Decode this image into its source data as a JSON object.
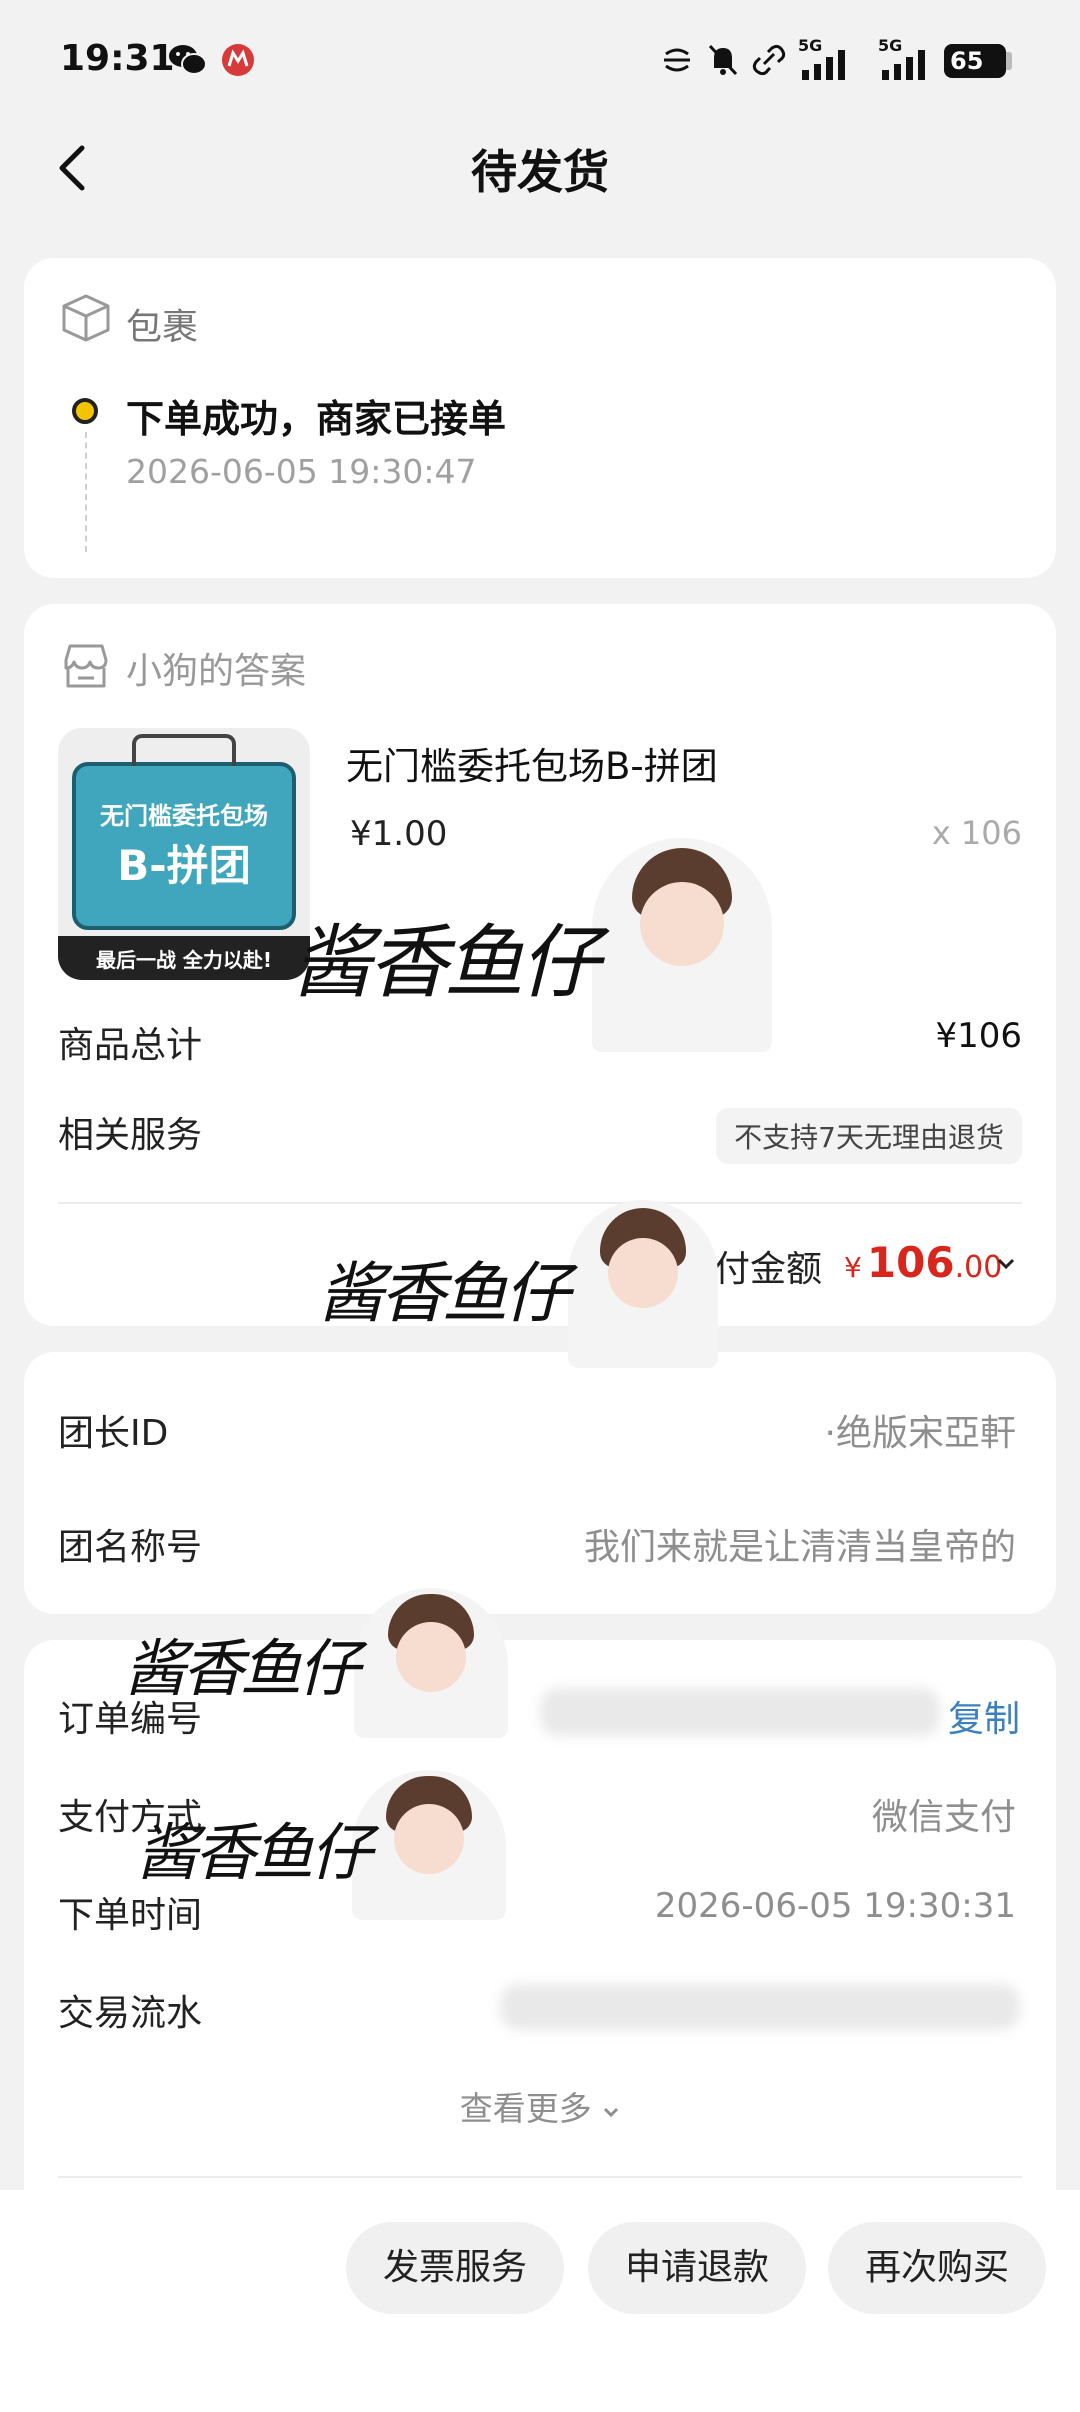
{
  "status_bar": {
    "time": "19:31",
    "battery": "65",
    "net_1": "5G",
    "net_2": "5G",
    "icons": [
      "wechat-icon",
      "app-badge-icon",
      "flash-icon",
      "mute-bell-icon",
      "link-icon",
      "signal-icon",
      "signal-icon",
      "battery-icon"
    ]
  },
  "header": {
    "title": "待发货"
  },
  "package": {
    "title": "包裹",
    "status": "下单成功，商家已接单",
    "time": "2026-06-05 19:30:47",
    "accent": "#f5c400"
  },
  "shop": {
    "name": "小狗的答案",
    "product": {
      "title": "无门槛委托包场B-拼团",
      "price": "¥1.00",
      "qty": "x 106",
      "thumb_line1": "无门槛委托包场",
      "thumb_line2": "B-拼团",
      "thumb_line3": "最后一战 全力以赴!"
    },
    "total_label": "商品总计",
    "total_value": "¥106",
    "service_label": "相关服务",
    "service_tag": "不支持7天无理由退货",
    "paid_label": "实付金额",
    "paid_symbol": "¥",
    "paid_int": "106",
    "paid_dec": ".00",
    "price_color": "#d9261c"
  },
  "group": {
    "leader_label": "团长ID",
    "leader_value": "·绝版宋亞軒",
    "name_label": "团名称号",
    "name_value": "我们来就是让清清当皇帝的"
  },
  "order": {
    "number_label": "订单编号",
    "copy_label": "复制",
    "pay_label": "支付方式",
    "pay_value": "微信支付",
    "time_label": "下单时间",
    "time_value": "2026-06-05 19:30:31",
    "flow_label": "交易流水",
    "more_label": "查看更多",
    "link_color": "#3d7fbf"
  },
  "watermark": {
    "text": "酱香鱼仔"
  },
  "bottom_bar": {
    "invoice": "发票服务",
    "refund": "申请退款",
    "rebuy": "再次购买"
  }
}
